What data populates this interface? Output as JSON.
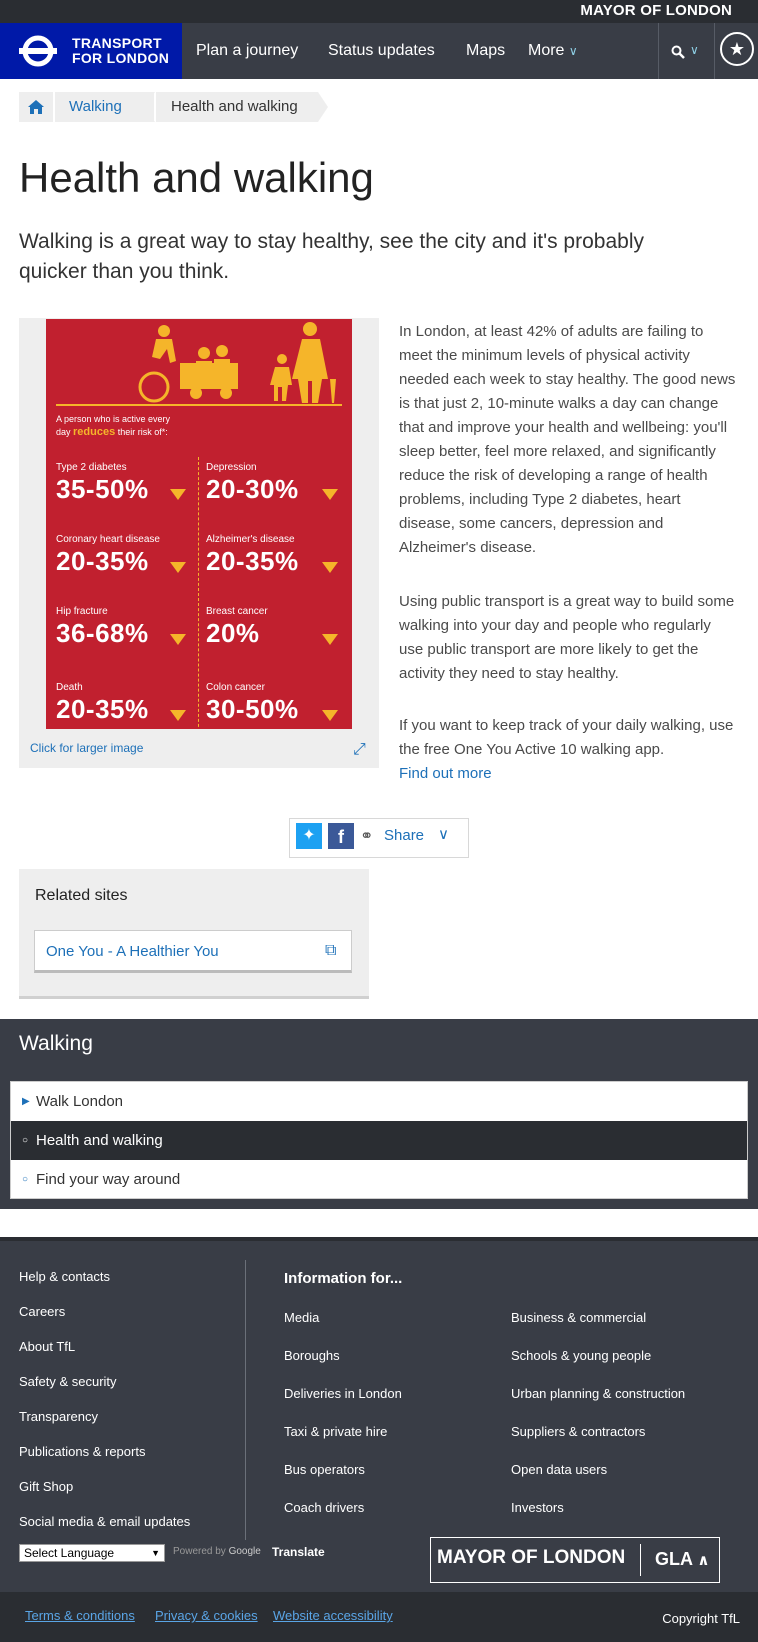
{
  "header": {
    "mayor_text": "MAYOR OF LONDON",
    "logo_line1": "TRANSPORT",
    "logo_line2": "FOR LONDON",
    "nav": [
      "Plan a journey",
      "Status updates",
      "Maps",
      "More"
    ]
  },
  "breadcrumb": {
    "items": [
      "Walking",
      "Health and walking"
    ]
  },
  "page": {
    "title": "Health and walking",
    "lead": "Walking is a great way to stay healthy, see the city and it's probably quicker than you think."
  },
  "infographic": {
    "intro_line1": "A person who is active every",
    "intro_line2_pre": "day ",
    "intro_line2_hl": "reduces",
    "intro_line2_post": " their risk of*:",
    "stats": [
      {
        "label": "Type 2 diabetes",
        "value": "35-50%"
      },
      {
        "label": "Depression",
        "value": "20-30%"
      },
      {
        "label": "Coronary heart disease",
        "value": "20-35%"
      },
      {
        "label": "Alzheimer's disease",
        "value": "20-35%"
      },
      {
        "label": "Hip fracture",
        "value": "36-68%"
      },
      {
        "label": "Breast cancer",
        "value": "20%"
      },
      {
        "label": "Death",
        "value": "20-35%"
      },
      {
        "label": "Colon cancer",
        "value": "30-50%"
      }
    ],
    "click_label": "Click for larger image"
  },
  "content": {
    "p1": "In London, at least 42% of adults are failing to meet the minimum levels of physical activity needed each week to stay healthy. The good news is that just 2, 10-minute walks a day can change that and improve your health and wellbeing: you'll sleep better, feel more relaxed, and significantly reduce the risk of developing a range of health problems, including Type 2 diabetes, heart disease, some cancers, depression and Alzheimer's disease.",
    "p2": "Using public transport is a great way to build some walking into your day and people who regularly use public transport are more likely to get the activity they need to stay healthy.",
    "p3": "If you want to keep track of your daily walking, use the free One You Active 10 walking app.",
    "find_out_more": "Find out more"
  },
  "share": {
    "label": "Share"
  },
  "related": {
    "heading": "Related sites",
    "link": "One You - A Healthier You"
  },
  "walking_section": {
    "heading": "Walking",
    "items": [
      "Walk London",
      "Health and walking",
      "Find your way around"
    ]
  },
  "footer": {
    "left_links": [
      "Help & contacts",
      "Careers",
      "About TfL",
      "Safety & security",
      "Transparency",
      "Publications & reports",
      "Gift Shop",
      "Social media & email updates"
    ],
    "info_heading": "Information for...",
    "info_col1": [
      "Media",
      "Boroughs",
      "Deliveries in London",
      "Taxi & private hire",
      "Bus operators",
      "Coach drivers"
    ],
    "info_col2": [
      "Business & commercial",
      "Schools & young people",
      "Urban planning & construction",
      "Suppliers & contractors",
      "Open data users",
      "Investors"
    ],
    "language_select": "Select Language",
    "powered_by": "Powered by",
    "google": "Google",
    "translate": "Translate",
    "mayor": "MAYOR OF LONDON",
    "gla": "GLA",
    "bottom_links": [
      "Terms & conditions",
      "Privacy & cookies",
      "Website accessibility"
    ],
    "copyright": "Copyright TfL"
  },
  "colors": {
    "tfl_blue": "#0019a8",
    "nav_bg": "#393d46",
    "link": "#1d70b8",
    "poster_red": "#c1202f",
    "poster_yellow": "#f5b52a"
  }
}
